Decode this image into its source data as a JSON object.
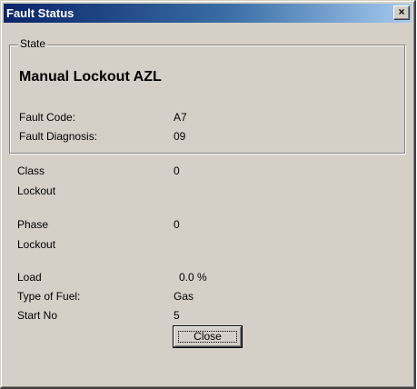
{
  "window": {
    "title": "Fault Status",
    "close_glyph": "×"
  },
  "state_group": {
    "legend": "State",
    "value": "Manual Lockout AZL",
    "fault_code_label": "Fault Code:",
    "fault_code_value": "A7",
    "fault_diagnosis_label": "Fault Diagnosis:",
    "fault_diagnosis_value": "09"
  },
  "class_lockout": {
    "label_line1": "Class",
    "label_line2": "Lockout",
    "value": "0"
  },
  "phase_lockout": {
    "label_line1": "Phase",
    "label_line2": "Lockout",
    "value": "0"
  },
  "load": {
    "label": "Load",
    "value": "0.0 %"
  },
  "fuel": {
    "label": "Type of Fuel:",
    "value": "Gas"
  },
  "start_no": {
    "label": "Start No",
    "value": "5"
  },
  "buttons": {
    "close_label": "Close"
  }
}
